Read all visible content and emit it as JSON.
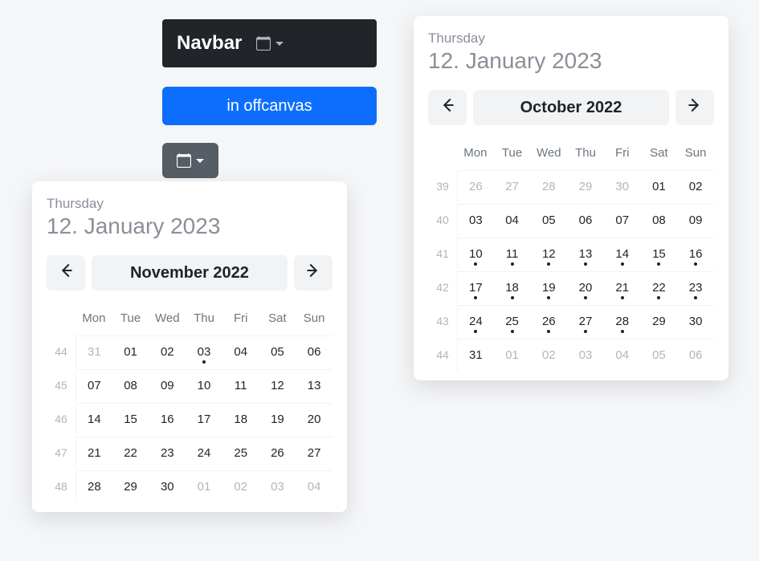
{
  "navbar": {
    "brand": "Navbar"
  },
  "offcanvas_button": "in offcanvas",
  "picker_header": {
    "weekday": "Thursday",
    "date": "12. January 2023"
  },
  "dow": [
    "Mon",
    "Tue",
    "Wed",
    "Thu",
    "Fri",
    "Sat",
    "Sun"
  ],
  "left_picker": {
    "title": "November 2022",
    "weeks": [
      {
        "num": "44",
        "days": [
          {
            "n": "31",
            "muted": true
          },
          {
            "n": "01"
          },
          {
            "n": "02"
          },
          {
            "n": "03",
            "dot": true
          },
          {
            "n": "04"
          },
          {
            "n": "05"
          },
          {
            "n": "06"
          }
        ]
      },
      {
        "num": "45",
        "days": [
          {
            "n": "07"
          },
          {
            "n": "08"
          },
          {
            "n": "09"
          },
          {
            "n": "10"
          },
          {
            "n": "11"
          },
          {
            "n": "12"
          },
          {
            "n": "13"
          }
        ]
      },
      {
        "num": "46",
        "days": [
          {
            "n": "14"
          },
          {
            "n": "15"
          },
          {
            "n": "16"
          },
          {
            "n": "17"
          },
          {
            "n": "18"
          },
          {
            "n": "19"
          },
          {
            "n": "20"
          }
        ]
      },
      {
        "num": "47",
        "days": [
          {
            "n": "21"
          },
          {
            "n": "22"
          },
          {
            "n": "23"
          },
          {
            "n": "24"
          },
          {
            "n": "25"
          },
          {
            "n": "26"
          },
          {
            "n": "27"
          }
        ]
      },
      {
        "num": "48",
        "days": [
          {
            "n": "28"
          },
          {
            "n": "29"
          },
          {
            "n": "30"
          },
          {
            "n": "01",
            "muted": true
          },
          {
            "n": "02",
            "muted": true
          },
          {
            "n": "03",
            "muted": true
          },
          {
            "n": "04",
            "muted": true
          }
        ]
      }
    ]
  },
  "right_picker": {
    "title": "October 2022",
    "weeks": [
      {
        "num": "39",
        "days": [
          {
            "n": "26",
            "muted": true
          },
          {
            "n": "27",
            "muted": true
          },
          {
            "n": "28",
            "muted": true
          },
          {
            "n": "29",
            "muted": true
          },
          {
            "n": "30",
            "muted": true
          },
          {
            "n": "01"
          },
          {
            "n": "02"
          }
        ]
      },
      {
        "num": "40",
        "days": [
          {
            "n": "03"
          },
          {
            "n": "04"
          },
          {
            "n": "05"
          },
          {
            "n": "06"
          },
          {
            "n": "07"
          },
          {
            "n": "08"
          },
          {
            "n": "09"
          }
        ]
      },
      {
        "num": "41",
        "days": [
          {
            "n": "10",
            "dot": true
          },
          {
            "n": "11",
            "dot": true
          },
          {
            "n": "12",
            "dot": true
          },
          {
            "n": "13",
            "dot": true
          },
          {
            "n": "14",
            "dot": true
          },
          {
            "n": "15",
            "dot": true
          },
          {
            "n": "16",
            "dot": true
          }
        ]
      },
      {
        "num": "42",
        "days": [
          {
            "n": "17",
            "dot": true
          },
          {
            "n": "18",
            "dot": true
          },
          {
            "n": "19",
            "dot": true
          },
          {
            "n": "20",
            "dot": true
          },
          {
            "n": "21",
            "dot": true
          },
          {
            "n": "22",
            "dot": true
          },
          {
            "n": "23",
            "dot": true
          }
        ]
      },
      {
        "num": "43",
        "days": [
          {
            "n": "24",
            "dot": true
          },
          {
            "n": "25",
            "dot": true
          },
          {
            "n": "26",
            "dot": true
          },
          {
            "n": "27",
            "dot": true
          },
          {
            "n": "28",
            "dot": true
          },
          {
            "n": "29"
          },
          {
            "n": "30"
          }
        ]
      },
      {
        "num": "44",
        "days": [
          {
            "n": "31"
          },
          {
            "n": "01",
            "muted": true
          },
          {
            "n": "02",
            "muted": true
          },
          {
            "n": "03",
            "muted": true
          },
          {
            "n": "04",
            "muted": true
          },
          {
            "n": "05",
            "muted": true
          },
          {
            "n": "06",
            "muted": true
          }
        ]
      }
    ]
  }
}
